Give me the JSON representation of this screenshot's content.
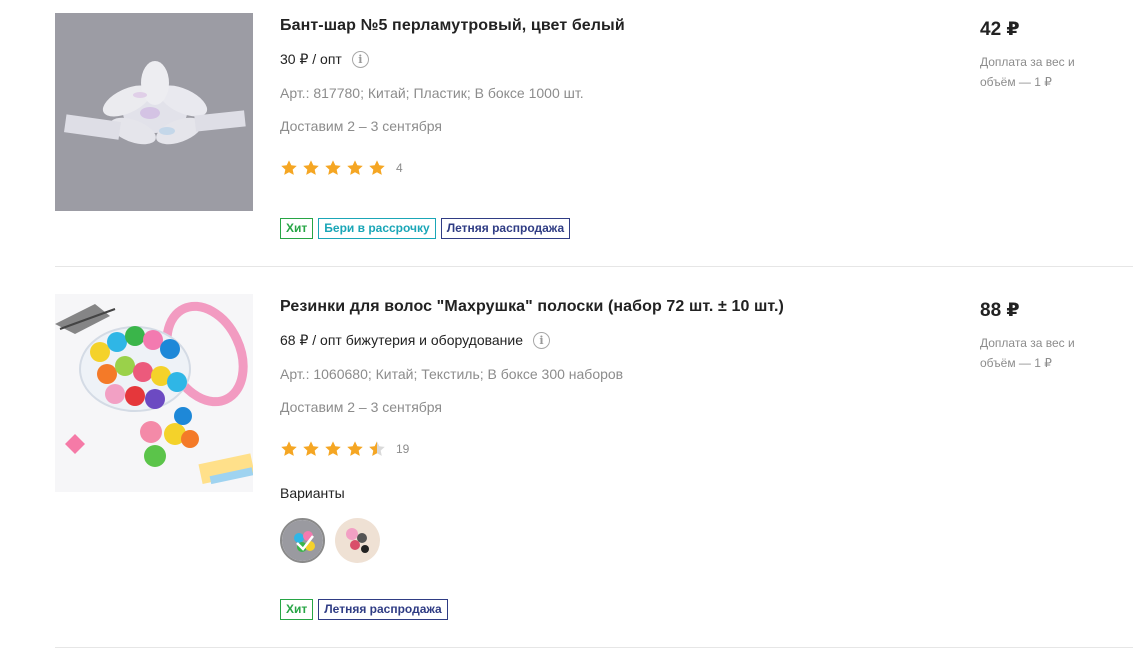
{
  "products": [
    {
      "title": "Бант-шар №5 перламутровый, цвет белый",
      "wholesale": "30 ₽ / опт",
      "info_icon": "info-icon",
      "attrs": "Арт.: 817780; Китай; Пластик; В боксе 1000 шт.",
      "delivery": "Доставим 2 – 3 сентября",
      "rating": 5,
      "rating_count": "4",
      "badges": [
        "Хит",
        "Бери в рассрочку",
        "Летняя распродажа"
      ],
      "price": "42 ₽",
      "surcharge": "Доплата за вес и объём — 1 ₽"
    },
    {
      "title": "Резинки для волос \"Махрушка\" полоски (набор 72 шт. ± 10 шт.)",
      "wholesale": "68 ₽ / опт бижутерия и оборудование",
      "info_icon": "info-icon",
      "attrs": "Арт.: 1060680; Китай; Текстиль; В боксе 300 наборов",
      "delivery": "Доставим 2 – 3 сентября",
      "rating": 4.5,
      "rating_count": "19",
      "variants_label": "Варианты",
      "variants_count": 2,
      "badges": [
        "Хит",
        "Летняя распродажа"
      ],
      "price": "88 ₽",
      "surcharge": "Доплата за вес и объём — 1 ₽"
    }
  ],
  "colors": {
    "star": "#f5a623",
    "badge_hit": "#27a545",
    "badge_installment": "#1aa6b7",
    "badge_sale": "#2f3c84"
  }
}
